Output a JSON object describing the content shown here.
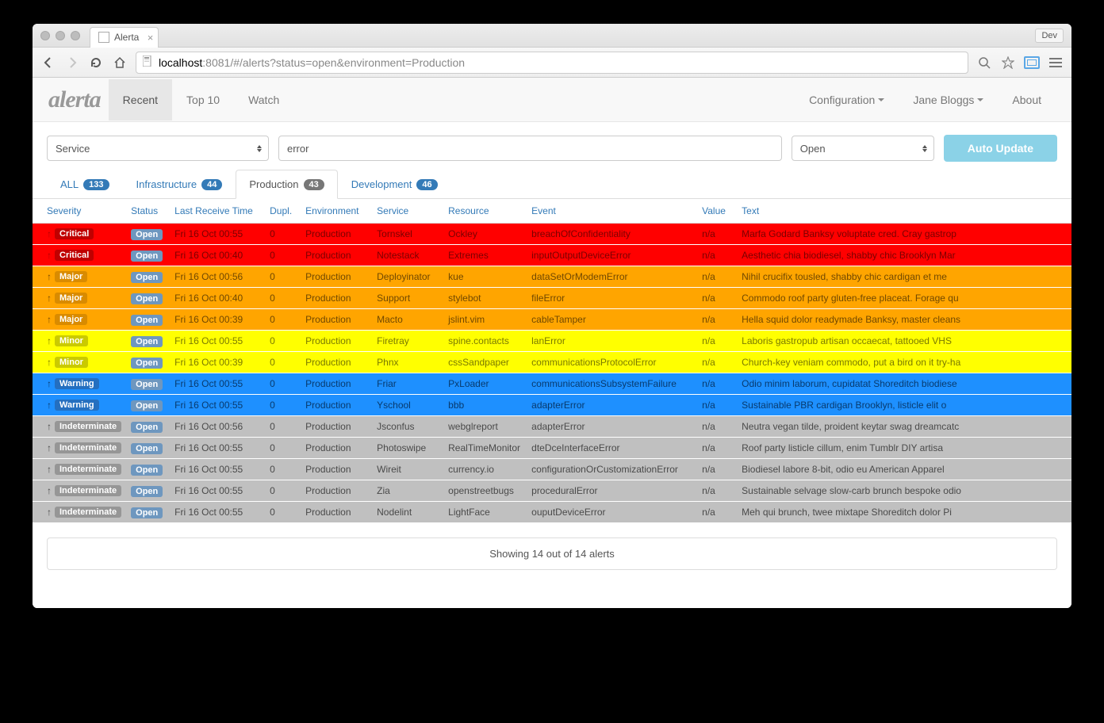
{
  "browser": {
    "tab_title": "Alerta",
    "dev_label": "Dev",
    "url_host": "localhost",
    "url_port": ":8081",
    "url_path": "/#/alerts?status=open&environment=Production"
  },
  "navbar": {
    "brand": "alerta",
    "items": [
      "Recent",
      "Top 10",
      "Watch"
    ],
    "right": {
      "config": "Configuration",
      "user": "Jane Bloggs",
      "about": "About"
    }
  },
  "filters": {
    "service_select": "Service",
    "search_value": "error",
    "status_select": "Open",
    "auto_update": "Auto Update"
  },
  "env_tabs": [
    {
      "label": "ALL",
      "count": "133",
      "active": false
    },
    {
      "label": "Infrastructure",
      "count": "44",
      "active": false
    },
    {
      "label": "Production",
      "count": "43",
      "active": true
    },
    {
      "label": "Development",
      "count": "46",
      "active": false
    }
  ],
  "columns": [
    "Severity",
    "Status",
    "Last Receive Time",
    "Dupl.",
    "Environment",
    "Service",
    "Resource",
    "Event",
    "Value",
    "Text"
  ],
  "alerts": [
    {
      "sev": "Critical",
      "sev_class": "critical",
      "arrow": "↑",
      "arrow_color": "#b30000",
      "status": "Open",
      "time": "Fri 16 Oct 00:55",
      "dupl": "0",
      "env": "Production",
      "svc": "Tornskel",
      "res": "Ockley",
      "event": "breachOfConfidentiality",
      "val": "n/a",
      "text": "Marfa Godard Banksy voluptate cred. Cray gastrop"
    },
    {
      "sev": "Critical",
      "sev_class": "critical",
      "arrow": "↑",
      "arrow_color": "#b30000",
      "status": "Open",
      "time": "Fri 16 Oct 00:40",
      "dupl": "0",
      "env": "Production",
      "svc": "Notestack",
      "res": "Extremes",
      "event": "inputOutputDeviceError",
      "val": "n/a",
      "text": "Aesthetic chia biodiesel, shabby chic Brooklyn Mar"
    },
    {
      "sev": "Major",
      "sev_class": "major",
      "arrow": "↑",
      "arrow_color": "#7a4a00",
      "status": "Open",
      "time": "Fri 16 Oct 00:56",
      "dupl": "0",
      "env": "Production",
      "svc": "Deployinator",
      "res": "kue",
      "event": "dataSetOrModemError",
      "val": "n/a",
      "text": "Nihil crucifix tousled, shabby chic cardigan et me"
    },
    {
      "sev": "Major",
      "sev_class": "major",
      "arrow": "↑",
      "arrow_color": "#7a4a00",
      "status": "Open",
      "time": "Fri 16 Oct 00:40",
      "dupl": "0",
      "env": "Production",
      "svc": "Support",
      "res": "stylebot",
      "event": "fileError",
      "val": "n/a",
      "text": "Commodo roof party gluten-free placeat. Forage qu"
    },
    {
      "sev": "Major",
      "sev_class": "major",
      "arrow": "↑",
      "arrow_color": "#7a4a00",
      "status": "Open",
      "time": "Fri 16 Oct 00:39",
      "dupl": "0",
      "env": "Production",
      "svc": "Macto",
      "res": "jslint.vim",
      "event": "cableTamper",
      "val": "n/a",
      "text": "Hella squid dolor readymade Banksy, master cleans"
    },
    {
      "sev": "Minor",
      "sev_class": "minor",
      "arrow": "↑",
      "arrow_color": "#7a7a00",
      "status": "Open",
      "time": "Fri 16 Oct 00:55",
      "dupl": "0",
      "env": "Production",
      "svc": "Firetray",
      "res": "spine.contacts",
      "event": "lanError",
      "val": "n/a",
      "text": "Laboris gastropub artisan occaecat, tattooed VHS"
    },
    {
      "sev": "Minor",
      "sev_class": "minor",
      "arrow": "↑",
      "arrow_color": "#7a7a00",
      "status": "Open",
      "time": "Fri 16 Oct 00:39",
      "dupl": "0",
      "env": "Production",
      "svc": "Phnx",
      "res": "cssSandpaper",
      "event": "communicationsProtocolError",
      "val": "n/a",
      "text": "Church-key veniam commodo, put a bird on it try-ha"
    },
    {
      "sev": "Warning",
      "sev_class": "warning",
      "arrow": "↑",
      "arrow_color": "#083a6d",
      "status": "Open",
      "time": "Fri 16 Oct 00:55",
      "dupl": "0",
      "env": "Production",
      "svc": "Friar",
      "res": "PxLoader",
      "event": "communicationsSubsystemFailure",
      "val": "n/a",
      "text": "Odio minim laborum, cupidatat Shoreditch biodiese"
    },
    {
      "sev": "Warning",
      "sev_class": "warning",
      "arrow": "↑",
      "arrow_color": "#083a6d",
      "status": "Open",
      "time": "Fri 16 Oct 00:55",
      "dupl": "0",
      "env": "Production",
      "svc": "Yschool",
      "res": "bbb",
      "event": "adapterError",
      "val": "n/a",
      "text": "Sustainable PBR cardigan Brooklyn, listicle elit o"
    },
    {
      "sev": "Indeterminate",
      "sev_class": "indeterminate",
      "arrow": "↑",
      "arrow_color": "#4a4a4a",
      "status": "Open",
      "time": "Fri 16 Oct 00:56",
      "dupl": "0",
      "env": "Production",
      "svc": "Jsconfus",
      "res": "webglreport",
      "event": "adapterError",
      "val": "n/a",
      "text": "Neutra vegan tilde, proident keytar swag dreamcatc"
    },
    {
      "sev": "Indeterminate",
      "sev_class": "indeterminate",
      "arrow": "↑",
      "arrow_color": "#4a4a4a",
      "status": "Open",
      "time": "Fri 16 Oct 00:55",
      "dupl": "0",
      "env": "Production",
      "svc": "Photoswipe",
      "res": "RealTimeMonitor",
      "event": "dteDceInterfaceError",
      "val": "n/a",
      "text": "Roof party listicle cillum, enim Tumblr DIY artisa"
    },
    {
      "sev": "Indeterminate",
      "sev_class": "indeterminate",
      "arrow": "↑",
      "arrow_color": "#4a4a4a",
      "status": "Open",
      "time": "Fri 16 Oct 00:55",
      "dupl": "0",
      "env": "Production",
      "svc": "Wireit",
      "res": "currency.io",
      "event": "configurationOrCustomizationError",
      "val": "n/a",
      "text": "Biodiesel labore 8-bit, odio eu American Apparel"
    },
    {
      "sev": "Indeterminate",
      "sev_class": "indeterminate",
      "arrow": "↑",
      "arrow_color": "#4a4a4a",
      "status": "Open",
      "time": "Fri 16 Oct 00:55",
      "dupl": "0",
      "env": "Production",
      "svc": "Zia",
      "res": "openstreetbugs",
      "event": "proceduralError",
      "val": "n/a",
      "text": "Sustainable selvage slow-carb brunch bespoke odio"
    },
    {
      "sev": "Indeterminate",
      "sev_class": "indeterminate",
      "arrow": "↑",
      "arrow_color": "#4a4a4a",
      "status": "Open",
      "time": "Fri 16 Oct 00:55",
      "dupl": "0",
      "env": "Production",
      "svc": "Nodelint",
      "res": "LightFace",
      "event": "ouputDeviceError",
      "val": "n/a",
      "text": "Meh qui brunch, twee mixtape Shoreditch dolor Pi"
    }
  ],
  "footer_text": "Showing 14 out of 14 alerts"
}
